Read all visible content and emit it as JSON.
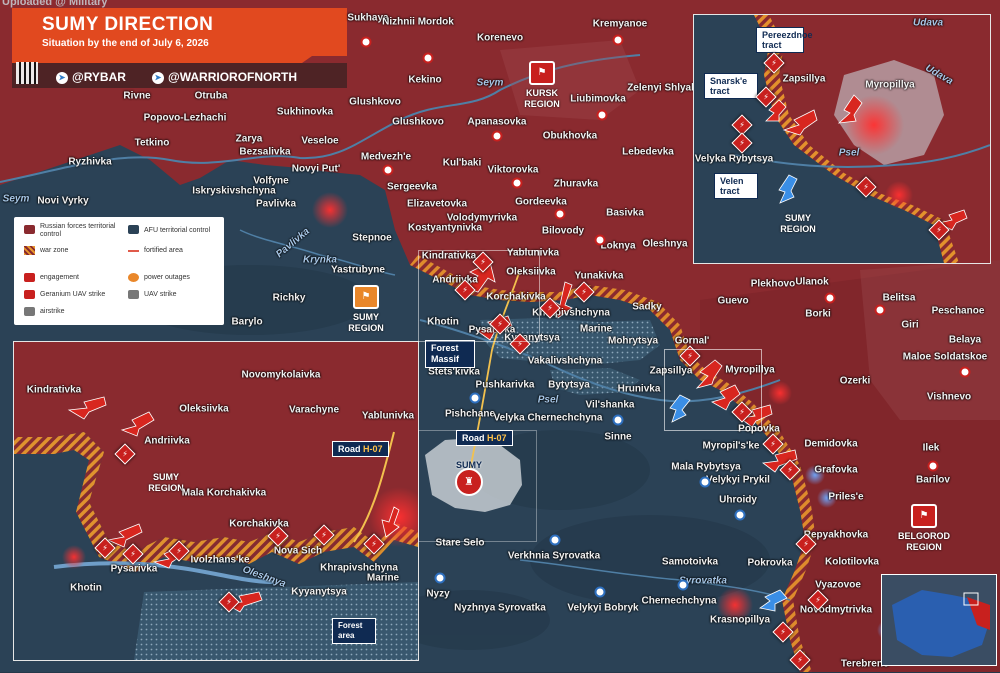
{
  "header": {
    "watermark": "Uploaded @ Military",
    "title": "SUMY DIRECTION",
    "subtitle": "Situation by the end of July 6, 2026",
    "handle1": "@RYBAR",
    "handle2": "@WARRIOROFNORTH"
  },
  "colors": {
    "russian": "#8a2a2f",
    "afu": "#2b4256",
    "warzone": "#e8962c",
    "engagement": "#c8201e",
    "accent_blue": "#0f2a52"
  },
  "legend": {
    "items": [
      {
        "label": "Russian forces territorial control",
        "icon": "russian-control-swatch"
      },
      {
        "label": "AFU territorial control",
        "icon": "afu-control-swatch"
      },
      {
        "label": "war zone",
        "icon": "war-zone-hatch"
      },
      {
        "label": "fortified area",
        "icon": "fortified-line"
      },
      {
        "label": "engagement",
        "icon": "engagement-icon"
      },
      {
        "label": "power outages",
        "icon": "power-outage-icon"
      },
      {
        "label": "Geranium UAV strike",
        "icon": "geranium-strike-icon"
      },
      {
        "label": "UAV strike",
        "icon": "uav-strike-icon"
      },
      {
        "label": "airstrike",
        "icon": "airstrike-icon"
      }
    ]
  },
  "regions": {
    "kursk": "KURSK REGION",
    "sumy": "SUMY REGION",
    "belgorod": "BELGOROD REGION",
    "sumy_city": "SUMY"
  },
  "rivers": {
    "seym1": "Seym",
    "seym2": "Seym",
    "pavlivka": "Pavlivka",
    "krynka": "Krynka",
    "psel": "Psel",
    "syrovatka": "Syrovatka"
  },
  "towns": {
    "sukhaya": "Sukhaya",
    "nizhnii_mordok": "Nizhnii Mordok",
    "korenevo": "Korenevo",
    "kremyanoe": "Kremyanoe",
    "rivne": "Rivne",
    "otruba": "Otruba",
    "kekino": "Kekino",
    "popovo": "Popovo-Lezhachi",
    "sukhinovka": "Sukhinovka",
    "glushkovo1": "Glushkovo",
    "glushkovo2": "Glushkovo",
    "apanasovka": "Apanasovka",
    "liubimovka": "Liubimovka",
    "zelenyi": "Zelenyi Shlyakh",
    "tetkino": "Tetkino",
    "zarya": "Zarya",
    "veseloe": "Veseloe",
    "bezsalivka": "Bezsalivka",
    "obukhovka": "Obukhovka",
    "ryzhivka": "Ryzhivka",
    "medvezhe": "Medvezh'e",
    "novyi_put": "Novyi Put'",
    "kurbaki": "Kul'baki",
    "viktorovka": "Viktorovka",
    "lebedevka": "Lebedevka",
    "volfyne": "Volfyne",
    "iskryskivshchyna": "Iskryskivshchyna",
    "sergeevka": "Sergeevka",
    "zhuravka": "Zhuravka",
    "novi_vyrky": "Novi Vyrky",
    "pavlivka": "Pavlivka",
    "elizavetovka": "Elizavetovka",
    "gordeevka": "Gordeevka",
    "volodymyrivka": "Volodymyrivka",
    "basivka": "Basivka",
    "kostyantynivka": "Kostyantynivka",
    "bilovody": "Bilovody",
    "stepnoe": "Stepnoe",
    "loknya": "Loknya",
    "oleshnya": "Oleshnya",
    "yablunivka": "Yablunivka",
    "kindrativka": "Kindrativka",
    "yastrubyne": "Yastrubyne",
    "oleksiivka": "Oleksiivka",
    "yunakivka": "Yunakivka",
    "andriivka": "Andriivka",
    "richky": "Richky",
    "korchakivka": "Korchakivka",
    "sadky": "Sadky",
    "guevo": "Guevo",
    "plekhovo": "Plekhovo",
    "ulanok": "Ulanok",
    "belitsa": "Belitsa",
    "peschanoe": "Peschanoe",
    "barylo": "Barylo",
    "khrapivshchyna": "Khrapivshchyna",
    "borki": "Borki",
    "giri": "Giri",
    "khotin": "Khotin",
    "pysarivka": "Pysarivka",
    "kyyanytsya": "Kyyanytsya",
    "marine": "Marine",
    "mohrytsya": "Mohrytsya",
    "gornal": "Gornal'",
    "belaya": "Belaya",
    "maloe": "Maloe Soldatskoe",
    "vakalivshchyna": "Vakalivshchyna",
    "stets_kivka": "Stets'kivka",
    "pushkarivka": "Pushkarivka",
    "bytytsya": "Bytytsya",
    "zapsillya": "Zapsillya",
    "myropillya": "Myropillya",
    "ozerki": "Ozerki",
    "vishnevo": "Vishnevo",
    "hrunivka": "Hrunivka",
    "pishchane": "Pishchane",
    "velyka_ch": "Velyka Chernechchyna",
    "vilshanka": "Vil'shanka",
    "sinne": "Sinne",
    "popovka": "Popovka",
    "myropilske": "Myropil's'ke",
    "demidovka": "Demidovka",
    "ilek": "Ilek",
    "mala_rybytsya": "Mala Rybytsya",
    "velykyi_prykil": "Velykyi Prykil",
    "grafovka": "Grafovka",
    "barilov": "Barilov",
    "priles": "Priles'e",
    "uhroidy": "Uhroidy",
    "stare_selo": "Stare Selo",
    "verkhnia": "Verkhnia Syrovatka",
    "samotoivka": "Samotoivka",
    "repyakhovka": "Repyakhovka",
    "kolotilovka": "Kolotilovka",
    "pokrovka": "Pokrovka",
    "vyazovoe": "Vyazovoe",
    "nyzy": "Nyzy",
    "nyzhnya": "Nyzhnya Syrovatka",
    "chernechchyna": "Chernechchyna",
    "velykyi_bobryk": "Velykyi Bobryk",
    "novodmytrivka": "Novodmytrivka",
    "krasnopillya": "Krasnopillya",
    "terebreno": "Terebreno"
  },
  "map_tags": {
    "forest_massif": "Forest Massif",
    "road_h07_label": "Road",
    "road_h07_code": "H-07"
  },
  "inset1": {
    "kindrativka": "Kindrativka",
    "novomykolaivka": "Novomykolaivka",
    "oleksiivka": "Oleksiivka",
    "varachyne": "Varachyne",
    "yablunivka": "Yablunivka",
    "andriivka": "Andriivka",
    "mala_korchakivka": "Mala Korchakivka",
    "korchakivka": "Korchakivka",
    "nova_sich": "Nova Sich",
    "ivolzhanske": "Ivolzhans'ke",
    "khrapivshchyna": "Khrapivshchyna",
    "marine": "Marine",
    "pysarivka": "Pysarivka",
    "khotin": "Khotin",
    "kyyanytsya": "Kyyanytsya",
    "oleshnya": "Oleshnya",
    "region": "SUMY REGION",
    "road_label": "Road",
    "road_code": "H-07",
    "forest_area": "Forest area"
  },
  "inset2": {
    "udava1": "Udava",
    "udava2": "Udava",
    "pereezdnoe": "Pereezdnoe tract",
    "snarske": "Snarsk'e tract",
    "zapsillya": "Zapsillya",
    "myropillya": "Myropillya",
    "velyka_rybytsya": "Velyka Rybytsya",
    "velen": "Velen tract",
    "psel": "Psel",
    "region": "SUMY REGION"
  }
}
